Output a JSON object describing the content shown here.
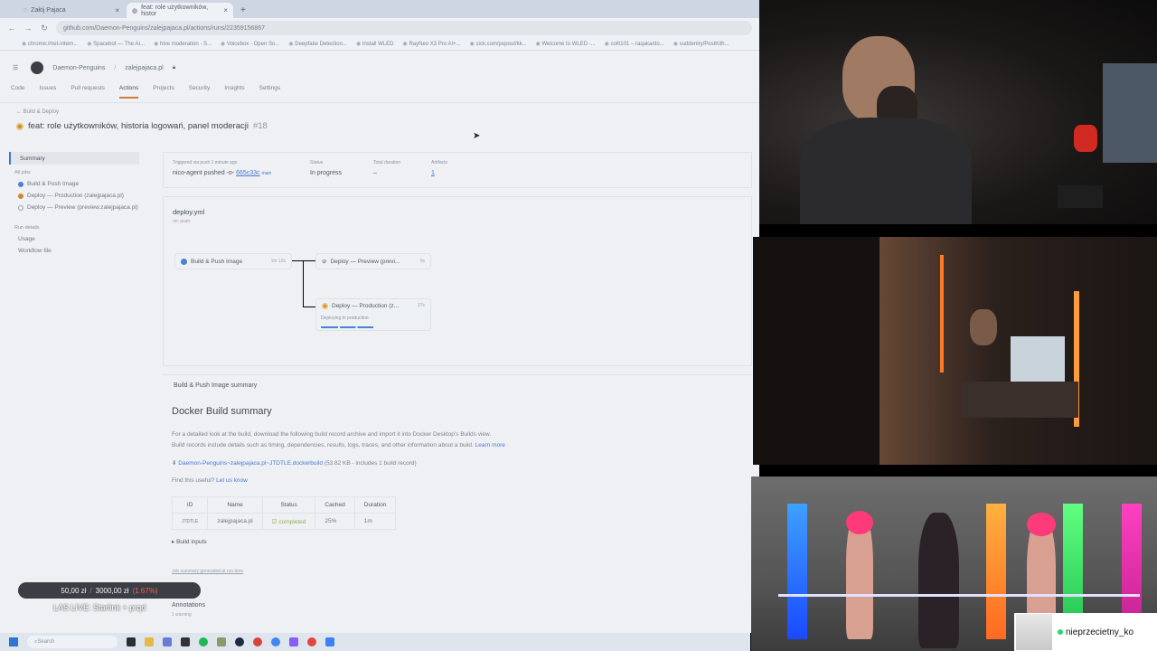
{
  "browser": {
    "tabs": [
      {
        "label": "Załój Pajaca",
        "active": false
      },
      {
        "label": "feat: role użytkowników, histor",
        "active": true
      }
    ],
    "url": "github.com/Daemon-Penguins/zalejpajaca.pl/actions/runs/22359156867",
    "bookmarks": [
      "chrome://net-intern...",
      "Spacebot — The AI...",
      "hive moderation - S...",
      "Voicebox - Open So...",
      "Deepfake Detection...",
      "Install WLED",
      "RayNeo X3 Pro AI+...",
      "sick.com/popout/kk...",
      "Welcome to WLED -...",
      "collt101 – raqaka/do...",
      "suddenlry/PostKith..."
    ]
  },
  "github": {
    "owner": "Daemon-Penguins",
    "repo": "zalejpajaca.pl",
    "nav": [
      "Code",
      "Issues",
      "Pull requests",
      "Actions",
      "Projects",
      "Security",
      "Insights",
      "Settings"
    ],
    "active_nav": "Actions",
    "breadcrumb": "← Build & Deploy",
    "run_title": "feat: role użytkowników, historia logowań, panel moderacji",
    "run_number": "#18",
    "sidebar": {
      "summary": "Summary",
      "all_jobs": "All jobs",
      "jobs": [
        {
          "label": "Build & Push Image",
          "status": "success"
        },
        {
          "label": "Deploy — Production (zalejpajaca.pl)",
          "status": "in_progress"
        },
        {
          "label": "Deploy — Preview (preview.zalejpajaca.pl)",
          "status": "skipped"
        }
      ],
      "run_details": "Run details",
      "usage": "Usage",
      "workflow_file": "Workflow file"
    },
    "meta": {
      "triggered_label": "Triggered via push 1 minute ago",
      "actor": "nico-agent pushed",
      "commit": "665c33c",
      "branch": "main",
      "status_label": "Status",
      "status": "In progress",
      "duration_label": "Total duration",
      "duration": "–",
      "artifacts_label": "Artifacts",
      "artifacts": "1"
    },
    "graph": {
      "workflow": "deploy.yml",
      "trigger": "on: push",
      "build_job": "Build & Push Image",
      "build_time": "1m 10s",
      "preview_job": "Deploy — Preview (previ...",
      "preview_time": "0s",
      "prod_job": "Deploy — Production (z...",
      "prod_time": "27s",
      "prod_sub": "Deploying to production",
      "progress": 1.0
    },
    "summary": {
      "job_header": "Build & Push Image summary",
      "title": "Docker Build summary",
      "text1": "For a detailed look at the build, download the following build record archive and import it into Docker Desktop's Builds view.",
      "text2": "Build records include details such as timing, dependencies, results, logs, traces, and other information about a build.",
      "learn_more": "Learn more",
      "record_link": "Daemon-Penguins~zalejpajaca.pl~JTDTLE.dockerbuild",
      "record_meta": "(53.82 KB - includes",
      "record_count": "1 build record)",
      "useful": "Find this useful?",
      "let_us_know": "Let us know",
      "table": {
        "headers": [
          "ID",
          "Name",
          "Status",
          "Cached",
          "Duration"
        ],
        "row": [
          "JTDTLE",
          "zalejpajaca.pl",
          "completed",
          "25%",
          "1m"
        ]
      },
      "build_inputs": "Build inputs",
      "generated": "Job summary generated at run-time",
      "annotations": "Annotations",
      "annotations_sub": "1 warning"
    }
  },
  "overlay": {
    "donation_current": "50,00 zł",
    "donation_separator": "/",
    "donation_goal": "3000,00 zł",
    "donation_pct": "(1.67%)",
    "live_title": "LAS LIVE: Starlink + prqd"
  },
  "taskbar": {
    "search_placeholder": "Search"
  },
  "chat": {
    "username": "nieprzecietny_ko"
  },
  "colors": {
    "accent": "#4a7ad0",
    "progress": "#c98a2d",
    "success": "#8fb05a",
    "pct": "#ff5a4a"
  }
}
